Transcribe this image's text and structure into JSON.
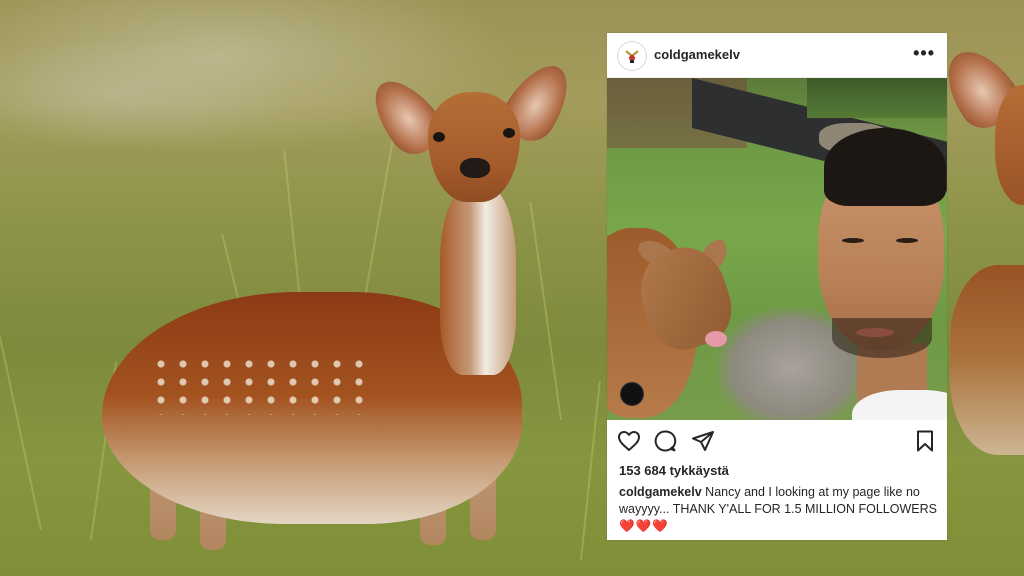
{
  "post": {
    "username": "coldgamekelv",
    "more_label": "•••",
    "likes": "153 684 tykkäystä",
    "caption_user": "coldgamekelv",
    "caption_text": "Nancy and I looking at my page like no wayyyy... THANK Y'ALL FOR 1.5 MILLION FOLLOWERS",
    "caption_hearts": "❤️❤️❤️"
  },
  "icons": [
    "heart-icon",
    "comment-icon",
    "share-icon",
    "bookmark-icon",
    "more-icon"
  ]
}
